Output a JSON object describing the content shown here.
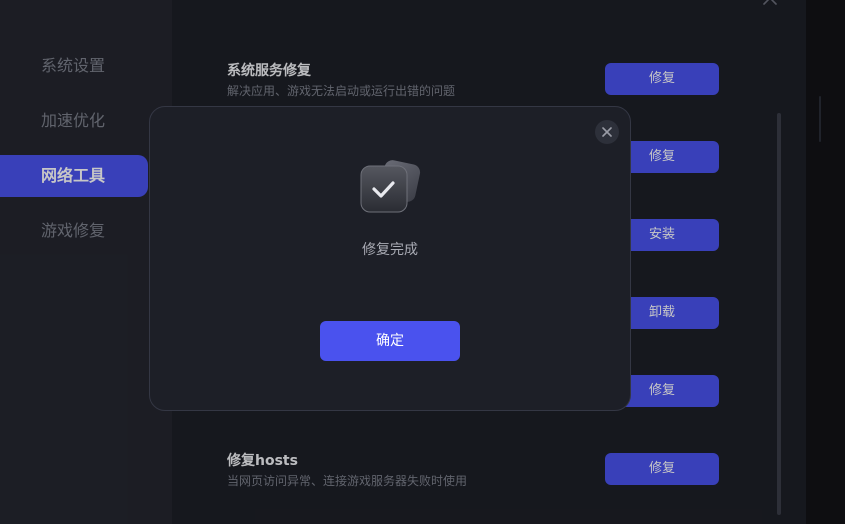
{
  "sidebar": {
    "items": [
      {
        "label": "系统设置"
      },
      {
        "label": "加速优化"
      },
      {
        "label": "网络工具"
      },
      {
        "label": "游戏修复"
      }
    ]
  },
  "rows": [
    {
      "title": "系统服务修复",
      "desc": "解决应用、游戏无法启动或运行出错的问题",
      "button": "修复"
    },
    {
      "button": "修复"
    },
    {
      "button": "安装"
    },
    {
      "button": "卸载"
    },
    {
      "button": "修复"
    },
    {
      "title": "修复hosts",
      "desc": "当网页访问异常、连接游戏服务器失败时使用",
      "button": "修复"
    }
  ],
  "modal": {
    "message": "修复完成",
    "confirm_label": "确定",
    "icon": "check-icon"
  },
  "colors": {
    "accent": "#4a52ee",
    "panel": "#1d1f27",
    "sidebar": "#24262f"
  }
}
